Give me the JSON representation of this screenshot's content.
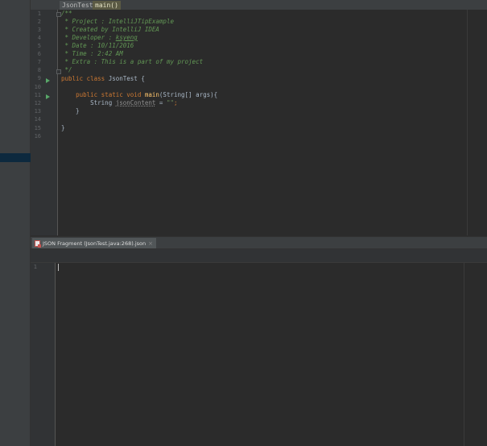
{
  "breadcrumb": [
    "JsonTest",
    "main()"
  ],
  "editor": {
    "line_numbers": [
      "1",
      "2",
      "3",
      "4",
      "5",
      "6",
      "7",
      "8",
      "9",
      "10",
      "11",
      "12",
      "13",
      "14",
      "15",
      "16"
    ],
    "code": {
      "l1": "/**",
      "l2": " * Project : IntelliJTipExample",
      "l3": " * Created by IntelliJ IDEA",
      "l4_prefix": " * Developer : ",
      "l4_name": "ksyeng",
      "l5": " * Date : 10/11/2016",
      "l6": " * Time : 2:42 AM",
      "l7": " * Extra : This is a part of my project",
      "l8": " */",
      "l9_kw": "public class",
      "l9_rest": " JsonTest {",
      "l11_indent": "    ",
      "l11_kw": "public static void",
      "l11_fn": "main",
      "l11_rest": "(String[] args){",
      "l12_indent": "        String ",
      "l12_var": "jsonContent",
      "l12_eq": " = ",
      "l12_str": "\"\"",
      "l12_semi": ";",
      "l13": "    }",
      "l15": "}"
    }
  },
  "fragment_tab": {
    "label": "JSON Fragment (JsonTest.java:268).json",
    "close_glyph": "×"
  },
  "fragment_editor": {
    "line_numbers": [
      "1"
    ]
  }
}
